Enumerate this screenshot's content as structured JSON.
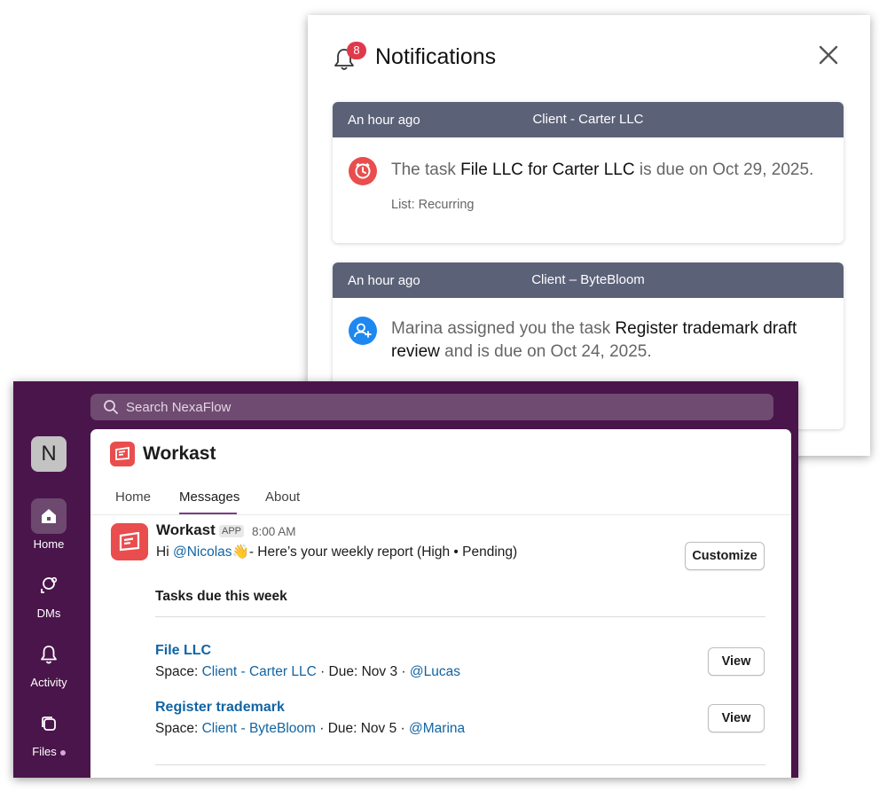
{
  "notifications": {
    "title": "Notifications",
    "badge_count": "8",
    "items": [
      {
        "time": "An hour ago",
        "client": "Client - Carter LLC",
        "text_before": "The task ",
        "task": "File LLC for Carter LLC",
        "text_after": " is due on Oct 29, 2025.",
        "list": "List: Recurring",
        "icon": "clock-icon",
        "icon_color": "#e94d4d"
      },
      {
        "time": "An hour ago",
        "client": "Client – ByteBloom",
        "text_before": "Marina assigned you the task ",
        "task": "Register trademark draft review",
        "text_after": " and is due on Oct 24, 2025.",
        "icon": "user-add-icon",
        "icon_color": "#1e88f0"
      }
    ]
  },
  "app": {
    "search_placeholder": "Search NexaFlow",
    "workspace_initial": "N",
    "nav": [
      {
        "label": "Home",
        "icon": "home-icon",
        "active": true
      },
      {
        "label": "DMs",
        "icon": "dms-icon"
      },
      {
        "label": "Activity",
        "icon": "bell-icon"
      },
      {
        "label": "Files",
        "icon": "files-icon"
      }
    ],
    "app_name": "Workast",
    "tabs": [
      "Home",
      "Messages",
      "About"
    ],
    "message": {
      "sender": "Workast",
      "tag": "APP",
      "time": "8:00 AM",
      "greeting_prefix": "Hi ",
      "mention": "@Nicolas",
      "emoji": "👋",
      "greeting_suffix": "- Here’s your weekly report (High • Pending)",
      "customize_label": "Customize"
    },
    "section_title": "Tasks due this week",
    "tasks": [
      {
        "name": "File LLC",
        "space_label": "Space: ",
        "space": "Client - Carter LLC",
        "due": " · Due: Nov 3 · ",
        "assignee": "@Lucas",
        "button": "View"
      },
      {
        "name": "Register trademark",
        "space_label": "Space: ",
        "space": "Client - ByteBloom",
        "due": " · Due: Nov 5 · ",
        "assignee": "@Marina",
        "button": "View"
      }
    ],
    "accent": "#4a154b"
  }
}
